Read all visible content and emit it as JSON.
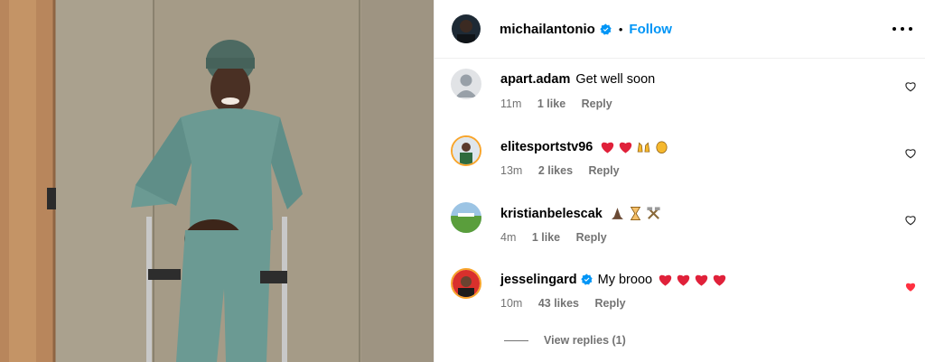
{
  "header": {
    "username": "michailantonio",
    "separator": "•",
    "follow_label": "Follow"
  },
  "comments": [
    {
      "username": "apart.adam",
      "text": "Get well soon",
      "time": "11m",
      "likes": "1 like",
      "reply": "Reply",
      "avatar": "default-avatar",
      "liked": false
    },
    {
      "username": "elitesportstv96",
      "text": "",
      "emojis": [
        "red-heart",
        "red-heart",
        "raising-hands",
        "clapping-hands"
      ],
      "time": "13m",
      "likes": "2 likes",
      "reply": "Reply",
      "avatar": "player-avatar",
      "liked": false
    },
    {
      "username": "kristianbelescak",
      "text": "",
      "emojis": [
        "praying-hands",
        "hourglass",
        "hammer-and-pick"
      ],
      "time": "4m",
      "likes": "1 like",
      "reply": "Reply",
      "avatar": "field-avatar",
      "liked": false
    },
    {
      "username": "jesselingard",
      "text": "My brooo",
      "emojis": [
        "red-heart",
        "red-heart",
        "red-heart",
        "red-heart"
      ],
      "time": "10m",
      "likes": "43 likes",
      "reply": "Reply",
      "avatar": "jesse-avatar",
      "liked": true,
      "verified": true
    }
  ],
  "view_replies": "View replies (1)",
  "colors": {
    "accent": "#0095f6",
    "muted": "#737373",
    "liked": "#ff3040",
    "border": "#efefef"
  }
}
